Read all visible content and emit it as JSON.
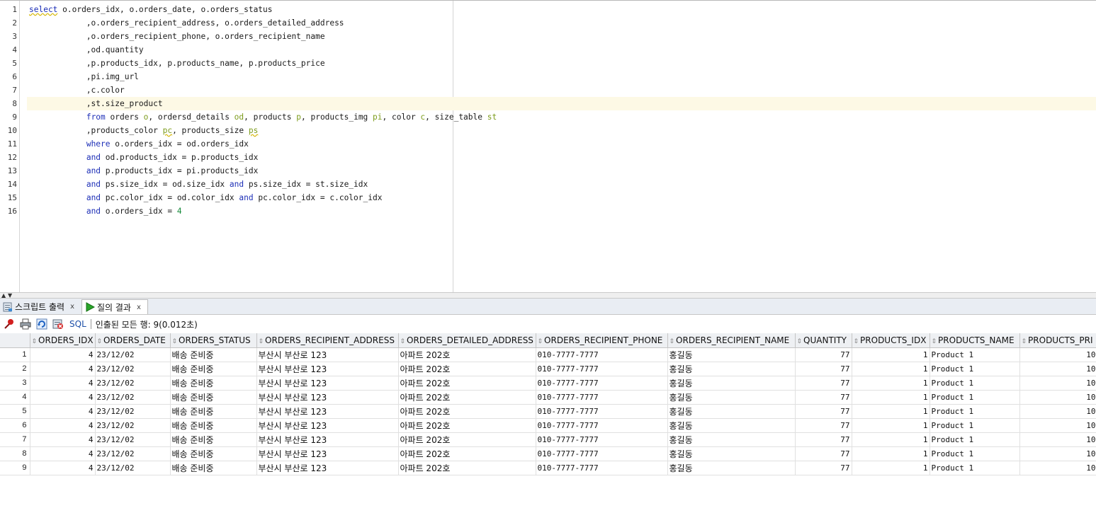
{
  "editor": {
    "lines": [
      [
        {
          "t": "select",
          "c": "kw squig"
        },
        {
          "t": " o.orders_idx, o.orders_date, o.orders_status"
        }
      ],
      [
        {
          "t": "            ,o.orders_recipient_address, o.orders_detailed_address"
        }
      ],
      [
        {
          "t": "            ,o.orders_recipient_phone, o.orders_recipient_name"
        }
      ],
      [
        {
          "t": "            ,od.quantity"
        }
      ],
      [
        {
          "t": "            ,p.products_idx, p.products_name, p.products_price"
        }
      ],
      [
        {
          "t": "            ,pi.img_url"
        }
      ],
      [
        {
          "t": "            ,c.color"
        }
      ],
      [
        {
          "t": "            ,st.size_product"
        }
      ],
      [
        {
          "t": "            "
        },
        {
          "t": "from",
          "c": "kw"
        },
        {
          "t": " orders "
        },
        {
          "t": "o",
          "c": "al"
        },
        {
          "t": ", ordersd_details "
        },
        {
          "t": "od",
          "c": "al"
        },
        {
          "t": ", products "
        },
        {
          "t": "p",
          "c": "al"
        },
        {
          "t": ", products_img "
        },
        {
          "t": "pi",
          "c": "al"
        },
        {
          "t": ", color "
        },
        {
          "t": "c",
          "c": "al"
        },
        {
          "t": ", size_table "
        },
        {
          "t": "st",
          "c": "al"
        }
      ],
      [
        {
          "t": "            ,products_color "
        },
        {
          "t": "pc",
          "c": "al squig"
        },
        {
          "t": ", products_size "
        },
        {
          "t": "ps",
          "c": "al squig"
        }
      ],
      [
        {
          "t": "            "
        },
        {
          "t": "where",
          "c": "kw"
        },
        {
          "t": " o.orders_idx = od.orders_idx"
        }
      ],
      [
        {
          "t": "            "
        },
        {
          "t": "and",
          "c": "kw"
        },
        {
          "t": " od.products_idx = p.products_idx"
        }
      ],
      [
        {
          "t": "            "
        },
        {
          "t": "and",
          "c": "kw"
        },
        {
          "t": " p.products_idx = pi.products_idx"
        }
      ],
      [
        {
          "t": "            "
        },
        {
          "t": "and",
          "c": "kw"
        },
        {
          "t": " ps.size_idx = od.size_idx "
        },
        {
          "t": "and",
          "c": "kw"
        },
        {
          "t": " ps.size_idx = st.size_idx"
        }
      ],
      [
        {
          "t": "            "
        },
        {
          "t": "and",
          "c": "kw"
        },
        {
          "t": " pc.color_idx = od.color_idx "
        },
        {
          "t": "and",
          "c": "kw"
        },
        {
          "t": " pc.color_idx = c.color_idx"
        }
      ],
      [
        {
          "t": "            "
        },
        {
          "t": "and",
          "c": "kw"
        },
        {
          "t": " o.orders_idx = "
        },
        {
          "t": "4",
          "c": "num"
        }
      ]
    ],
    "active_line": 8
  },
  "tabs": [
    {
      "label": "스크립트 출력",
      "icon": "script-output-icon",
      "close": "x"
    },
    {
      "label": "질의 결과",
      "icon": "run-query-icon",
      "close": "x"
    }
  ],
  "toolbar": {
    "sql_label": "SQL",
    "status": "인출된 모든 행: 9(0.012초)"
  },
  "grid": {
    "columns": [
      {
        "name": "ORDERS_IDX",
        "w": 92,
        "align": "r"
      },
      {
        "name": "ORDERS_DATE",
        "w": 106,
        "align": "l"
      },
      {
        "name": "ORDERS_STATUS",
        "w": 122,
        "align": "l",
        "k": true
      },
      {
        "name": "ORDERS_RECIPIENT_ADDRESS",
        "w": 200,
        "align": "l",
        "k": true
      },
      {
        "name": "ORDERS_DETAILED_ADDRESS",
        "w": 194,
        "align": "l",
        "k": true
      },
      {
        "name": "ORDERS_RECIPIENT_PHONE",
        "w": 186,
        "align": "l"
      },
      {
        "name": "ORDERS_RECIPIENT_NAME",
        "w": 180,
        "align": "l",
        "k": true
      },
      {
        "name": "QUANTITY",
        "w": 80,
        "align": "r"
      },
      {
        "name": "PRODUCTS_IDX",
        "w": 110,
        "align": "r"
      },
      {
        "name": "PRODUCTS_NAME",
        "w": 127,
        "align": "l"
      },
      {
        "name": "PRODUCTS_PRI",
        "w": 110,
        "align": "r"
      }
    ],
    "rows": [
      {
        "n": "1",
        "cells": [
          "4",
          "23/12/02",
          "배송 준비중",
          "부산시 부산로 123",
          "아파트 202호",
          "010-7777-7777",
          "홍길동",
          "77",
          "1",
          "Product 1",
          "10"
        ]
      },
      {
        "n": "2",
        "cells": [
          "4",
          "23/12/02",
          "배송 준비중",
          "부산시 부산로 123",
          "아파트 202호",
          "010-7777-7777",
          "홍길동",
          "77",
          "1",
          "Product 1",
          "10"
        ]
      },
      {
        "n": "3",
        "cells": [
          "4",
          "23/12/02",
          "배송 준비중",
          "부산시 부산로 123",
          "아파트 202호",
          "010-7777-7777",
          "홍길동",
          "77",
          "1",
          "Product 1",
          "10"
        ]
      },
      {
        "n": "4",
        "cells": [
          "4",
          "23/12/02",
          "배송 준비중",
          "부산시 부산로 123",
          "아파트 202호",
          "010-7777-7777",
          "홍길동",
          "77",
          "1",
          "Product 1",
          "10"
        ]
      },
      {
        "n": "5",
        "cells": [
          "4",
          "23/12/02",
          "배송 준비중",
          "부산시 부산로 123",
          "아파트 202호",
          "010-7777-7777",
          "홍길동",
          "77",
          "1",
          "Product 1",
          "10"
        ]
      },
      {
        "n": "6",
        "cells": [
          "4",
          "23/12/02",
          "배송 준비중",
          "부산시 부산로 123",
          "아파트 202호",
          "010-7777-7777",
          "홍길동",
          "77",
          "1",
          "Product 1",
          "10"
        ]
      },
      {
        "n": "7",
        "cells": [
          "4",
          "23/12/02",
          "배송 준비중",
          "부산시 부산로 123",
          "아파트 202호",
          "010-7777-7777",
          "홍길동",
          "77",
          "1",
          "Product 1",
          "10"
        ]
      },
      {
        "n": "8",
        "cells": [
          "4",
          "23/12/02",
          "배송 준비중",
          "부산시 부산로 123",
          "아파트 202호",
          "010-7777-7777",
          "홍길동",
          "77",
          "1",
          "Product 1",
          "10"
        ]
      },
      {
        "n": "9",
        "cells": [
          "4",
          "23/12/02",
          "배송 준비중",
          "부산시 부산로 123",
          "아파트 202호",
          "010-7777-7777",
          "홍길동",
          "77",
          "1",
          "Product 1",
          "10"
        ]
      }
    ]
  }
}
